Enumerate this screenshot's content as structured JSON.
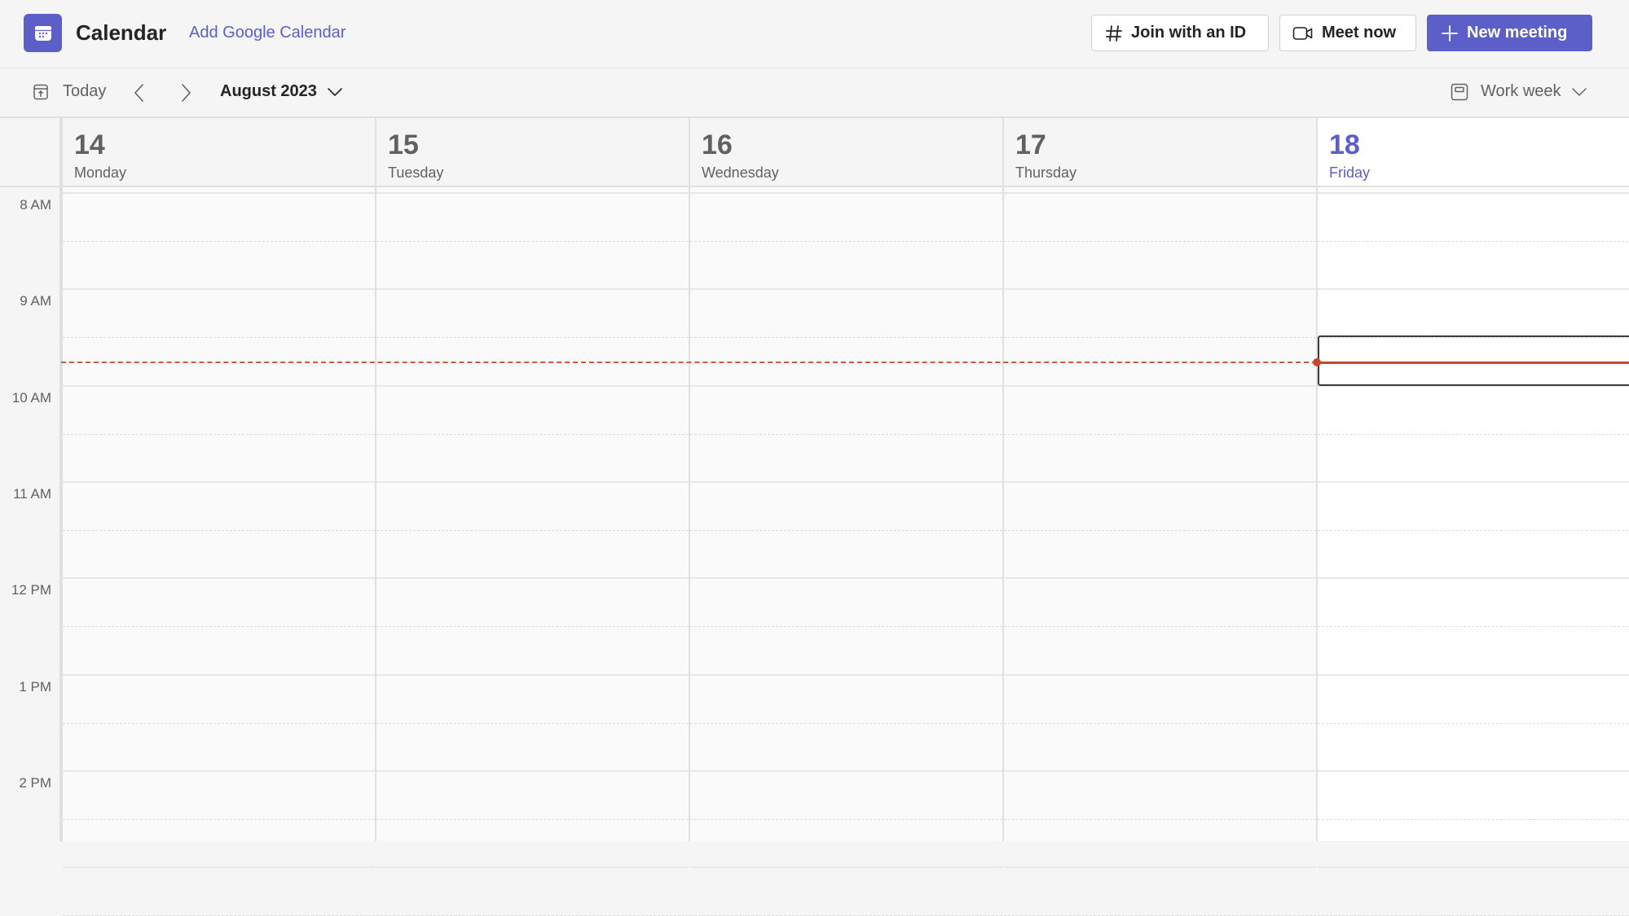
{
  "header": {
    "app_icon": "calendar-icon",
    "title": "Calendar",
    "add_google_calendar": "Add Google Calendar",
    "buttons": {
      "join_with_id": {
        "label": "Join with an ID",
        "icon": "hash-icon"
      },
      "meet_now": {
        "label": "Meet now",
        "icon": "video-camera-icon"
      },
      "new_meeting": {
        "label": "New meeting",
        "icon": "plus-icon"
      }
    }
  },
  "toolbar": {
    "today_label": "Today",
    "today_icon": "calendar-today-icon",
    "prev_icon": "chevron-left-icon",
    "next_icon": "chevron-right-icon",
    "month_label": "August 2023",
    "view_label": "Work week",
    "view_icon": "work-week-view-icon"
  },
  "colors": {
    "accent": "#5b5fc7",
    "current_time": "#c4472f"
  },
  "days": [
    {
      "number": "14",
      "name": "Monday",
      "is_today": false
    },
    {
      "number": "15",
      "name": "Tuesday",
      "is_today": false
    },
    {
      "number": "16",
      "name": "Wednesday",
      "is_today": false
    },
    {
      "number": "17",
      "name": "Thursday",
      "is_today": false
    },
    {
      "number": "18",
      "name": "Friday",
      "is_today": true
    }
  ],
  "time_labels": [
    "8 AM",
    "9 AM",
    "10 AM",
    "11 AM",
    "12 PM",
    "1 PM",
    "2 PM"
  ],
  "current_time_marker": {
    "day": "Friday",
    "hour_fraction": 9.75
  },
  "selected_slot": {
    "day": "Friday",
    "start": "9:30 AM",
    "end": "10:00 AM"
  }
}
